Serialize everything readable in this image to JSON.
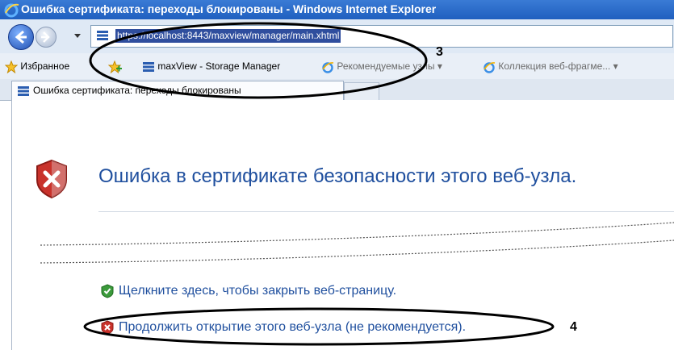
{
  "window": {
    "title": "Ошибка сертификата: переходы блокированы - Windows Internet Explorer"
  },
  "address": {
    "url": "https://localhost:8443/maxview/manager/main.xhtml"
  },
  "favorites": {
    "favorites_label": "Избранное",
    "items": [
      {
        "label": "maxView - Storage Manager"
      },
      {
        "label": "Рекомендуемые узлы ▾"
      },
      {
        "label": "Коллекция веб-фрагме... ▾"
      }
    ]
  },
  "tab": {
    "label": "Ошибка сертификата: переходы блокированы"
  },
  "page": {
    "heading": "Ошибка в сертификате безопасности этого веб-узла.",
    "close_link": "Щелкните здесь, чтобы закрыть веб-страницу.",
    "continue_link": "Продолжить открытие этого веб-узла (не рекомендуется)."
  },
  "annotations": {
    "label_3": "3",
    "label_4": "4"
  },
  "colors": {
    "link": "#1f4f9e",
    "titlebar": "#1f5fbf",
    "url_highlight": "#2f4e9e"
  }
}
